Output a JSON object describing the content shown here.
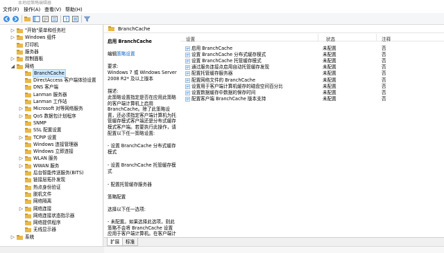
{
  "window": {
    "title": "本地组策略编辑器"
  },
  "menu": [
    "文件(F)",
    "操作(A)",
    "查看(V)",
    "帮助(H)"
  ],
  "toolbar_icons": [
    "back-icon",
    "forward-icon",
    "up-folder-icon",
    "show-hide-tree-icon",
    "refresh-icon",
    "export-list-icon",
    "help-icon",
    "properties-icon",
    "filter-icon"
  ],
  "tree": {
    "items": [
      {
        "label": "\"开始\"菜单和任务栏",
        "depth": 2,
        "expander": "▷"
      },
      {
        "label": "Windows 组件",
        "depth": 2,
        "expander": "▷"
      },
      {
        "label": "打印机",
        "depth": 2,
        "expander": ""
      },
      {
        "label": "服务器",
        "depth": 2,
        "expander": ""
      },
      {
        "label": "控制面板",
        "depth": 2,
        "expander": "▷"
      },
      {
        "label": "网络",
        "depth": 2,
        "expander": "◢"
      },
      {
        "label": "BranchCache",
        "depth": 3,
        "expander": "",
        "selected": true
      },
      {
        "label": "DirectAccess 客户端体验设置",
        "depth": 3,
        "expander": ""
      },
      {
        "label": "DNS 客户端",
        "depth": 3,
        "expander": ""
      },
      {
        "label": "Lanman 服务器",
        "depth": 3,
        "expander": ""
      },
      {
        "label": "Lanman 工作站",
        "depth": 3,
        "expander": ""
      },
      {
        "label": "Microsoft 对等网络服务",
        "depth": 3,
        "expander": "▷"
      },
      {
        "label": "QoS 数据包计划程序",
        "depth": 3,
        "expander": "▷"
      },
      {
        "label": "SNMP",
        "depth": 3,
        "expander": ""
      },
      {
        "label": "SSL 配置设置",
        "depth": 3,
        "expander": ""
      },
      {
        "label": "TCPIP 设置",
        "depth": 3,
        "expander": "▷"
      },
      {
        "label": "Windows 连接管理器",
        "depth": 3,
        "expander": ""
      },
      {
        "label": "Windows 立即连接",
        "depth": 3,
        "expander": ""
      },
      {
        "label": "WLAN 服务",
        "depth": 3,
        "expander": "▷"
      },
      {
        "label": "WWAN 服务",
        "depth": 3,
        "expander": "▷"
      },
      {
        "label": "后台智能传送服务(BITS)",
        "depth": 3,
        "expander": ""
      },
      {
        "label": "链接层拓扑发现",
        "depth": 3,
        "expander": ""
      },
      {
        "label": "热点身份验证",
        "depth": 3,
        "expander": ""
      },
      {
        "label": "脱机文件",
        "depth": 3,
        "expander": ""
      },
      {
        "label": "网络隔离",
        "depth": 3,
        "expander": ""
      },
      {
        "label": "网络连接",
        "depth": 3,
        "expander": "▷"
      },
      {
        "label": "网络连接状态指示器",
        "depth": 3,
        "expander": ""
      },
      {
        "label": "网络提供程序",
        "depth": 3,
        "expander": ""
      },
      {
        "label": "无线显示器",
        "depth": 3,
        "expander": ""
      },
      {
        "label": "系统",
        "depth": 2,
        "expander": "▷"
      }
    ]
  },
  "header": {
    "title": "BranchCache"
  },
  "description": {
    "heading": "启用 BranchCache",
    "edit_prefix": "编辑",
    "edit_link": "策略设置",
    "req_label": "要求:",
    "req_text": "Windows 7 或 Windows Server 2008 R2* 及以上版本",
    "desc_label": "描述:",
    "desc_text": "此策略设置指定是否在应用此策略的客户端计算机上启用 BranchCache。除了此策略设置，还必须指定客户端计算机为托管缓存模式客户端还是分布式缓存模式客户端。若要执行此操作，请配置以下任一策略设置:",
    "b1": "- 设置 BranchCache 分布式缓存模式",
    "b2": "- 设置 BranchCache 托管缓存模式",
    "b3": "- 配置托管缓存服务器",
    "pc_label": "策略配置",
    "pc_text": "选择以下任一选项:",
    "nc_text": "- 未配置。如果选择此选项，则此策略不会将 BranchCache 设置应用于客户端计算机。在客户端计算机上，域中的",
    "tail": "…"
  },
  "table": {
    "headers": {
      "setting": "设置",
      "state": "状态",
      "comment": "注释"
    },
    "rows": [
      {
        "name": "启用 BranchCache",
        "state": "未配置",
        "comment": "否",
        "icon": "policy-icon"
      },
      {
        "name": "设置 BranchCache 分布式缓存模式",
        "state": "未配置",
        "comment": "否",
        "icon": "policy-icon"
      },
      {
        "name": "设置 BranchCache 托管缓存模式",
        "state": "未配置",
        "comment": "否",
        "icon": "policy-icon"
      },
      {
        "name": "通过服务连接点启用自动托管缓存发现",
        "state": "未配置",
        "comment": "否",
        "icon": "policy-icon"
      },
      {
        "name": "配置托管缓存服务器",
        "state": "未配置",
        "comment": "否",
        "icon": "policy-icon"
      },
      {
        "name": "配置网络文件的 BranchCache",
        "state": "未配置",
        "comment": "否",
        "icon": "policy-icon"
      },
      {
        "name": "设置用于客户端计算机缓存的磁盘空间百分比",
        "state": "未配置",
        "comment": "否",
        "icon": "policy-icon"
      },
      {
        "name": "设置数据缓存中数据的保存时间",
        "state": "未配置",
        "comment": "否",
        "icon": "policy-icon"
      },
      {
        "name": "配置客户端 BranchCache 版本支持",
        "state": "未配置",
        "comment": "否",
        "icon": "policy-icon"
      }
    ]
  },
  "tabs": [
    {
      "label": "扩展",
      "active": true
    },
    {
      "label": "标准",
      "active": false
    }
  ],
  "colors": {
    "folder": "#e8b84a",
    "folder_dark": "#c9962e",
    "selection": "#cce8ff",
    "link": "#0066cc"
  }
}
